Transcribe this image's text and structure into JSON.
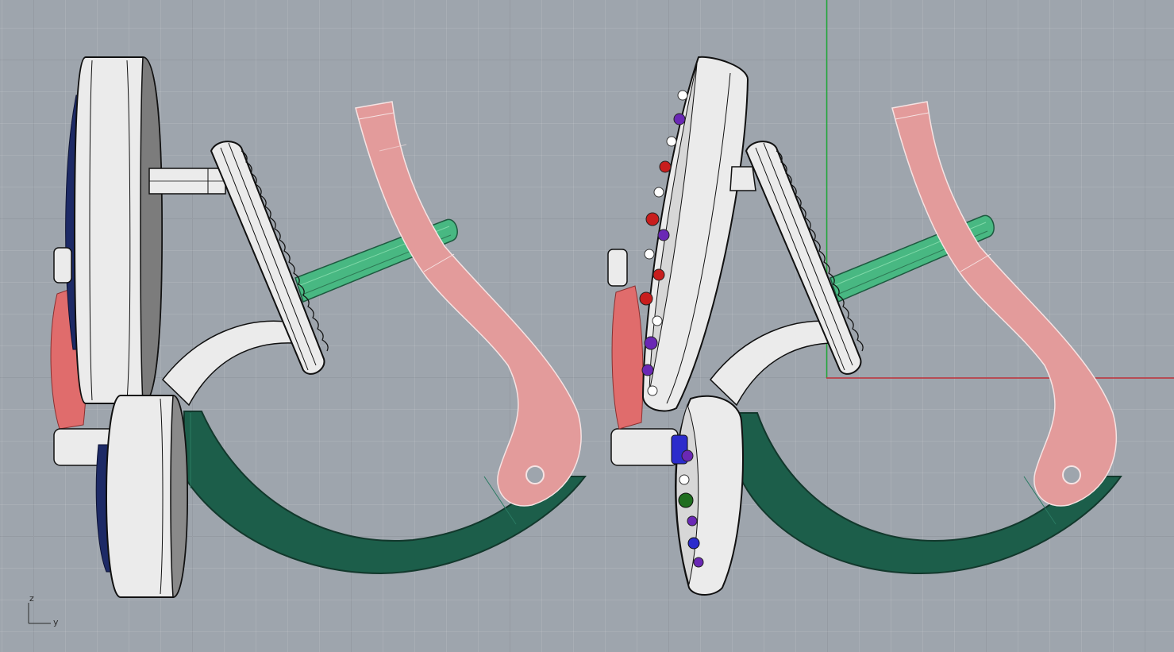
{
  "viewport": {
    "name": "Right",
    "background_color": "#9ea5ad",
    "world_axes": {
      "x_axis_color": "#c0313a",
      "z_axis_color": "#21a83a"
    }
  },
  "axis_widget": {
    "vertical_label": "z",
    "horizontal_label": "y"
  },
  "materials": {
    "metal": "#e9e9e9",
    "pink_part": "#e39b9b",
    "green_band": "#1c5e4a",
    "green_pin": "#48b882",
    "red_gem": "#e06c6c",
    "navy_gem": "#1d2a66",
    "stone_purple": "#6a28b5",
    "stone_red": "#c81d1d",
    "stone_blue": "#2c2ccc",
    "stone_green": "#1f6e1f"
  },
  "models": [
    {
      "id": "ring-left",
      "style": "plain"
    },
    {
      "id": "ring-right",
      "style": "pave-stones"
    }
  ]
}
